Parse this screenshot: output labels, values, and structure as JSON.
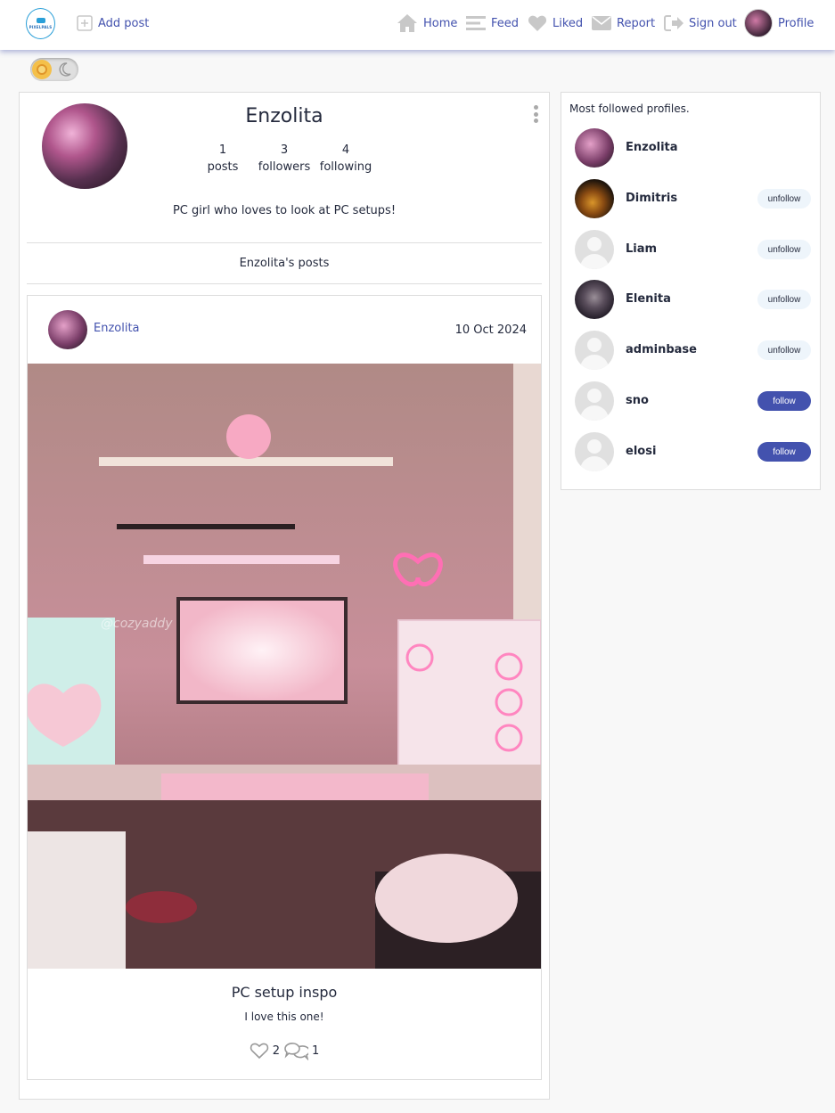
{
  "nav": {
    "logo_text": "PIXELPALS",
    "add_post": "Add post",
    "home": "Home",
    "feed": "Feed",
    "liked": "Liked",
    "report": "Report",
    "sign_out": "Sign out",
    "profile": "Profile"
  },
  "profile": {
    "name": "Enzolita",
    "posts_count": "1",
    "posts_label": "posts",
    "followers_count": "3",
    "followers_label": "followers",
    "following_count": "4",
    "following_label": "following",
    "bio": "PC girl who loves to look at PC setups!",
    "posts_heading": "Enzolita's posts"
  },
  "post": {
    "author": "Enzolita",
    "date": "10 Oct 2024",
    "image_watermark": "@cozyaddy",
    "title": "PC setup inspo",
    "text": "I love this one!",
    "likes": "2",
    "comments": "1"
  },
  "sidebar": {
    "title": "Most followed profiles.",
    "profiles": [
      {
        "name": "Enzolita",
        "button": ""
      },
      {
        "name": "Dimitris",
        "button": "unfollow"
      },
      {
        "name": "Liam",
        "button": "unfollow"
      },
      {
        "name": "Elenita",
        "button": "unfollow"
      },
      {
        "name": "adminbase",
        "button": "unfollow"
      },
      {
        "name": "sno",
        "button": "follow"
      },
      {
        "name": "elosi",
        "button": "follow"
      }
    ]
  },
  "colors": {
    "accent": "#4352ae",
    "text": "#242a3d",
    "unfollow_bg": "#eef5fb"
  }
}
